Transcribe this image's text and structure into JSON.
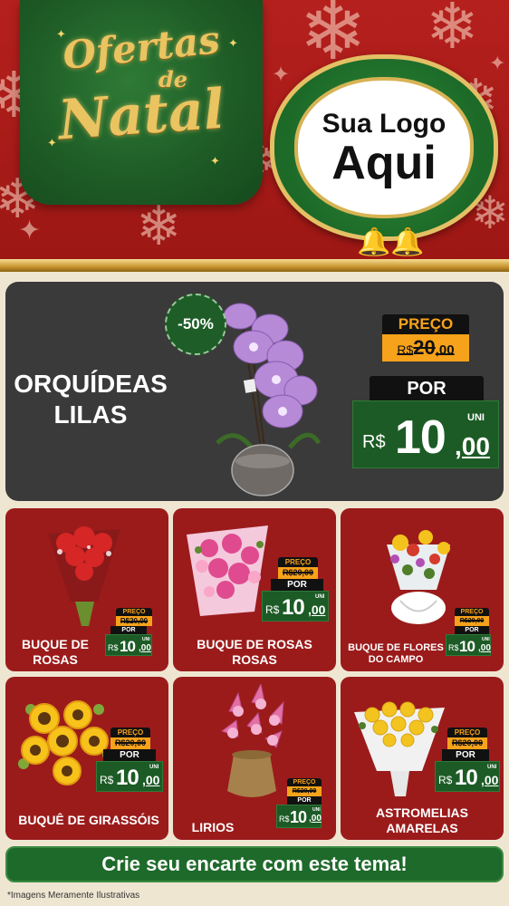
{
  "header": {
    "title_line1": "Ofertas",
    "title_line2": "de",
    "title_line3": "Natal",
    "logo_line1": "Sua Logo",
    "logo_line2": "Aqui"
  },
  "featured": {
    "name": "ORQUÍDEAS LILAS",
    "discount": "-50%",
    "price_label": "PREÇO",
    "old_currency": "R$",
    "old_price_int": "20",
    "old_price_cents": ",00",
    "por_label": "POR",
    "currency": "R$",
    "price_int": "10",
    "price_cents": ",00",
    "unit": "UNI"
  },
  "products": [
    {
      "name": "BUQUE DE ROSAS",
      "price_label": "PREÇO",
      "old_price": "R$20,00",
      "por_label": "POR",
      "currency": "R$",
      "price_int": "10",
      "price_cents": ",00",
      "unit": "UNI"
    },
    {
      "name": "BUQUE DE ROSAS ROSAS",
      "price_label": "PREÇO",
      "old_price": "R$20,00",
      "por_label": "POR",
      "currency": "R$",
      "price_int": "10",
      "price_cents": ",00",
      "unit": "UNI"
    },
    {
      "name": "BUQUE DE FLORES DO CAMPO",
      "price_label": "PREÇO",
      "old_price": "R$20,00",
      "por_label": "POR",
      "currency": "R$",
      "price_int": "10",
      "price_cents": ",00",
      "unit": "UNI"
    },
    {
      "name": "BUQUÊ DE GIRASSÓIS",
      "price_label": "PREÇO",
      "old_price": "R$20,00",
      "por_label": "POR",
      "currency": "R$",
      "price_int": "10",
      "price_cents": ",00",
      "unit": "UNI"
    },
    {
      "name": "LIRIOS",
      "price_label": "PREÇO",
      "old_price": "R$20,00",
      "por_label": "POR",
      "currency": "R$",
      "price_int": "10",
      "price_cents": ",00",
      "unit": "UNI"
    },
    {
      "name": "ASTROMELIAS AMARELAS",
      "price_label": "PREÇO",
      "old_price": "R$20,00",
      "por_label": "POR",
      "currency": "R$",
      "price_int": "10",
      "price_cents": ",00",
      "unit": "UNI"
    }
  ],
  "footer": {
    "cta": "Crie seu encarte com este tema!",
    "disclaimer": "*Imagens Meramente Ilustrativas"
  },
  "colors": {
    "background_red": "#b5201d",
    "card_red": "#9b1b1b",
    "green": "#1c5b25",
    "gold": "#e3c064",
    "orange_tag": "#f7a21b",
    "dark_card": "#3a3a3a"
  },
  "icons": [
    "snowflake-icon",
    "star-icon",
    "bell-icon"
  ]
}
